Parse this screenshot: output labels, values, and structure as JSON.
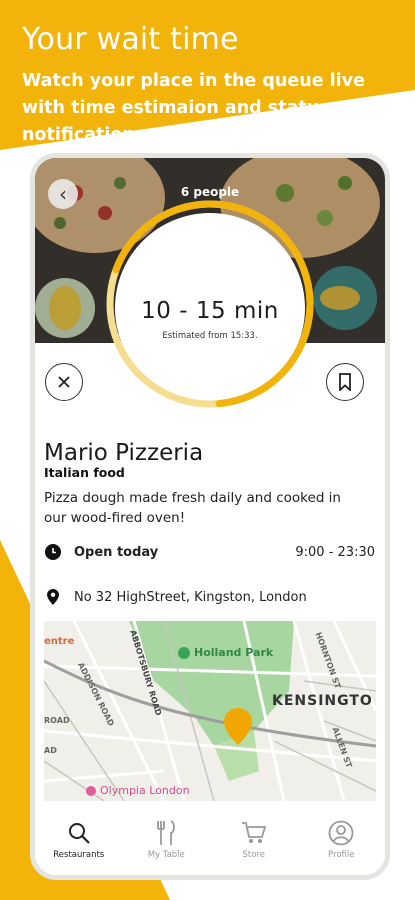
{
  "promo": {
    "headline": "Your wait time",
    "subline": "Watch your place in the queue live with time estimaion and status notifications."
  },
  "queue": {
    "people": "6 people",
    "time": "10 - 15 min",
    "estimated": "Estimated from 15:33.",
    "progress_fraction": 0.68
  },
  "restaurant": {
    "name": "Mario Pizzeria",
    "category": "Italian food",
    "description": "Pizza dough made fresh daily and cooked in our wood-fired oven!",
    "open_label": "Open today",
    "hours": "9:00 - 23:30",
    "address": "No 32 HighStreet, Kingston, London"
  },
  "map": {
    "labels": {
      "centre": "entre",
      "addison": "ADDISON ROAD",
      "abbotsbury": "ABBOTSBURY ROAD",
      "holland": "Holland Park",
      "kensington": "KENSINGTO",
      "hornton": "HORNTON ST",
      "allen": "ALLEN ST",
      "olympia": "Olympia London",
      "side1": "ROAD",
      "side2": "AD"
    }
  },
  "nav": {
    "items": [
      {
        "label": "Restaurants",
        "icon": "search-icon"
      },
      {
        "label": "My Table",
        "icon": "cutlery-icon"
      },
      {
        "label": "Store",
        "icon": "cart-icon"
      },
      {
        "label": "Profile",
        "icon": "profile-icon"
      }
    ]
  },
  "colors": {
    "accent": "#F2B40A",
    "map_green": "#A8D6A0",
    "pin": "#F0A800"
  }
}
